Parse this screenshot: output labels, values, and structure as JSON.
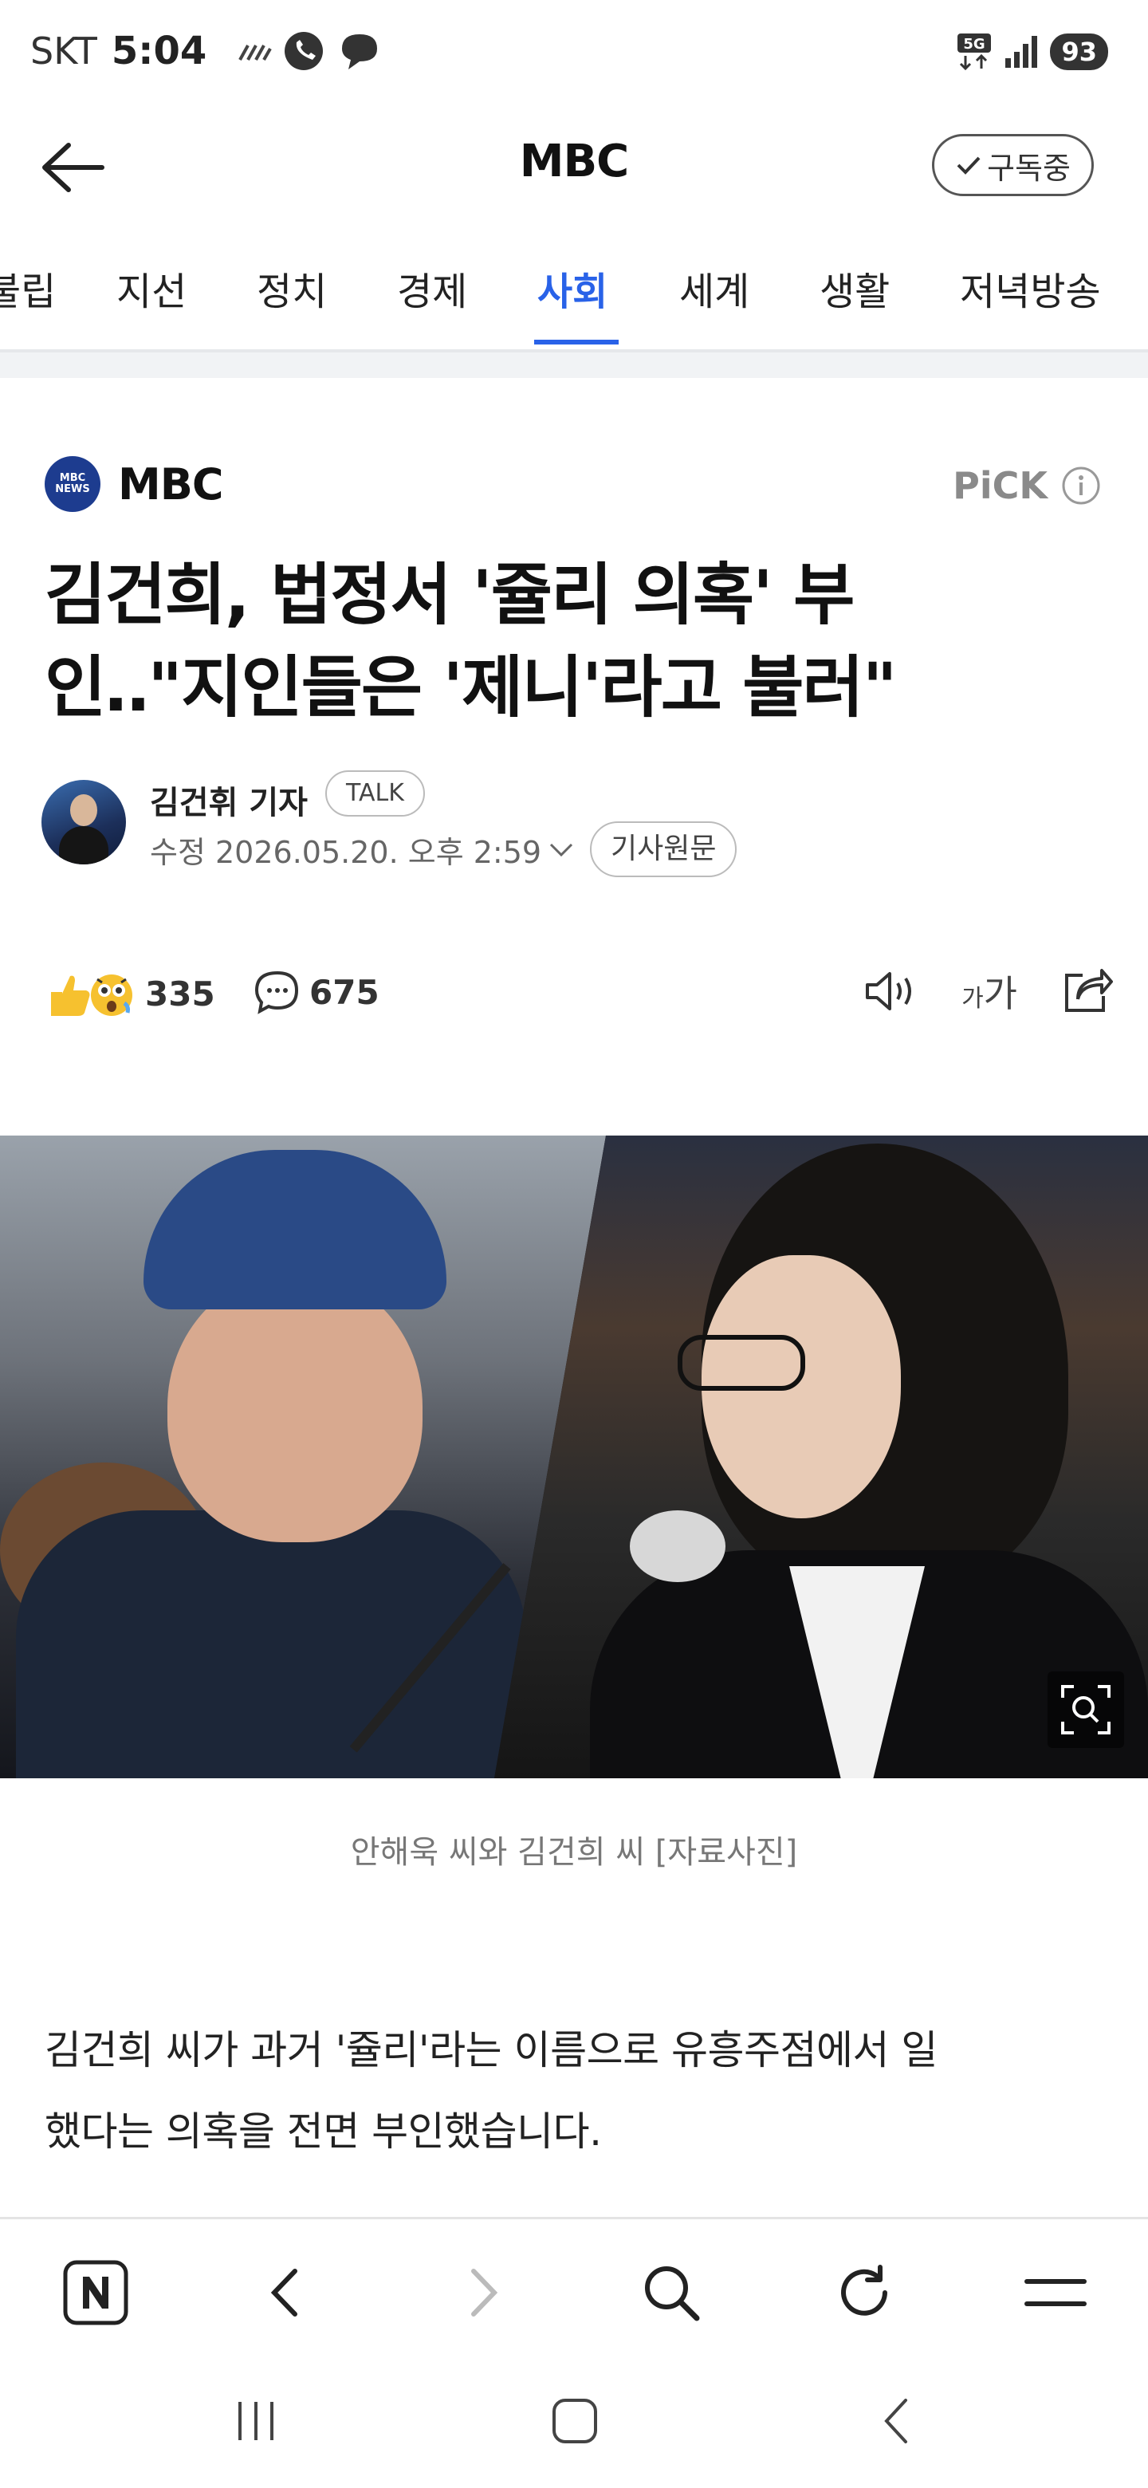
{
  "status_bar": {
    "carrier": "SKT",
    "time": "5:04",
    "network": "5G",
    "battery": "93"
  },
  "header": {
    "title": "MBC",
    "subscribe_label": "구독중"
  },
  "category_tabs": [
    {
      "label": "불립",
      "active": false
    },
    {
      "label": "지선",
      "active": false
    },
    {
      "label": "정치",
      "active": false
    },
    {
      "label": "경제",
      "active": false
    },
    {
      "label": "사회",
      "active": true
    },
    {
      "label": "세계",
      "active": false
    },
    {
      "label": "생활",
      "active": false
    },
    {
      "label": "저녁방송",
      "active": false
    }
  ],
  "article": {
    "press_logo_text": "MBC NEWS",
    "press_name": "MBC",
    "pick_label": "PiCK",
    "headline_line1": "김건희, 법정서 '쥴리 의혹' 부",
    "headline_line2": "인‥\"지인들은 '제니'라고 불러\"",
    "reporter": "김건휘 기자",
    "talk_label": "TALK",
    "edit_date": "수정 2026.05.20. 오후 2:59",
    "original_label": "기사원문",
    "reaction_count": "335",
    "comment_count": "675",
    "font_size_label_small": "가",
    "font_size_label_large": "가",
    "photo_caption": "안해욱 씨와 김건희 씨 [자료사진]",
    "body_line1": "김건희 씨가 과거 '쥴리'라는 이름으로 유흥주점에서 일",
    "body_line2": "했다는 의혹을 전면 부인했습니다."
  },
  "colors": {
    "accent": "#2962e8",
    "text": "#111111",
    "muted": "#777777"
  }
}
